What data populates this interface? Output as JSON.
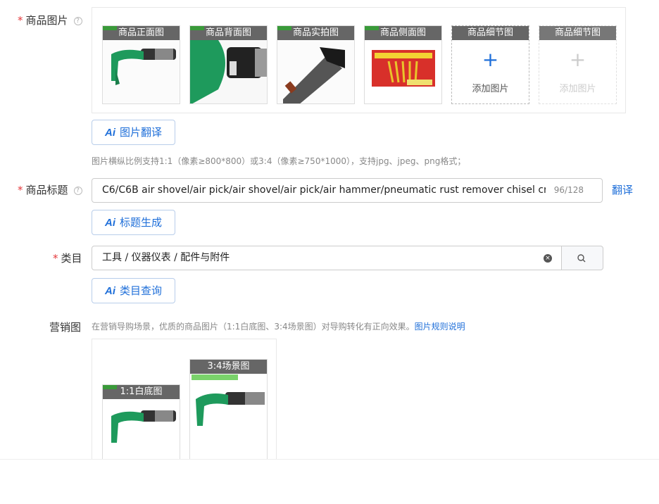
{
  "images": {
    "label": "商品图片",
    "required_mark": "*",
    "help_icon": "?",
    "thumbs": [
      {
        "caption": "商品正面图",
        "icon": "air-hammer-front-photo"
      },
      {
        "caption": "商品背面图",
        "icon": "air-hammer-back-photo"
      },
      {
        "caption": "商品实拍图",
        "icon": "air-hammer-real-photo"
      },
      {
        "caption": "商品侧面图",
        "icon": "chisel-set-photo"
      }
    ],
    "add_slots": [
      {
        "caption": "商品细节图",
        "plus": "+",
        "text": "添加图片"
      },
      {
        "caption": "商品细节图",
        "plus": "+",
        "text": "添加图片"
      }
    ],
    "ai_button": {
      "ai": "Ai",
      "label": "图片翻译"
    },
    "hint": "图片横纵比例支持1:1（像素≥800*800）或3:4（像素≥750*1000），支持jpg、jpeg、png格式；"
  },
  "title": {
    "label": "商品标题",
    "required_mark": "*",
    "help_icon": "?",
    "value": "C6/C6B air shovel/air pick/air shovel/air pick/air hammer/pneumatic rust remover chisel crush",
    "count": "96/128",
    "translate_link": "翻译",
    "ai_button": {
      "ai": "Ai",
      "label": "标题生成"
    }
  },
  "category": {
    "label": "类目",
    "required_mark": "*",
    "value": "工具 / 仪器仪表 / 配件与附件",
    "clear_icon": "×",
    "ai_button": {
      "ai": "Ai",
      "label": "类目查询"
    }
  },
  "marketing": {
    "label": "营销图",
    "hint": "在营销导购场景，优质的商品图片（1:1白底图、3:4场景图）对导购转化有正向效果。",
    "hint_link": "图片规则说明",
    "thumbs": [
      {
        "caption": "1:1白底图",
        "icon": "air-hammer-white-bg-photo"
      },
      {
        "caption": "3:4场景图",
        "icon": "air-hammer-scene-photo"
      }
    ]
  },
  "colors": {
    "accent": "#1f6fd9",
    "required": "#e4393c",
    "hammer_green": "#1e9a5c"
  }
}
